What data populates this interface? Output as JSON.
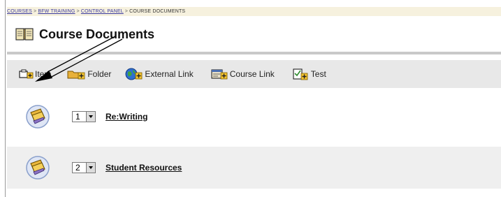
{
  "breadcrumb": {
    "items": [
      "COURSES",
      "BFW TRAINING",
      "CONTROL PANEL",
      "COURSE DOCUMENTS"
    ],
    "separator": ">"
  },
  "page": {
    "title": "Course Documents",
    "icon": "open-book-icon"
  },
  "toolbar": {
    "buttons": [
      {
        "label": "Item",
        "icon": "add-item-icon"
      },
      {
        "label": "Folder",
        "icon": "add-folder-icon"
      },
      {
        "label": "External Link",
        "icon": "add-external-link-icon"
      },
      {
        "label": "Course Link",
        "icon": "add-course-link-icon"
      },
      {
        "label": "Test",
        "icon": "add-test-icon"
      }
    ]
  },
  "content": {
    "items": [
      {
        "order": "1",
        "title": "Re:Writing",
        "icon": "folder-icon"
      },
      {
        "order": "2",
        "title": "Student Resources",
        "icon": "folder-icon"
      }
    ]
  },
  "colors": {
    "breadcrumb_bg": "#f6f1de",
    "toolbar_bg": "#e8e8e8",
    "alt_row_bg": "#efefef",
    "link": "#3a3aa0"
  }
}
